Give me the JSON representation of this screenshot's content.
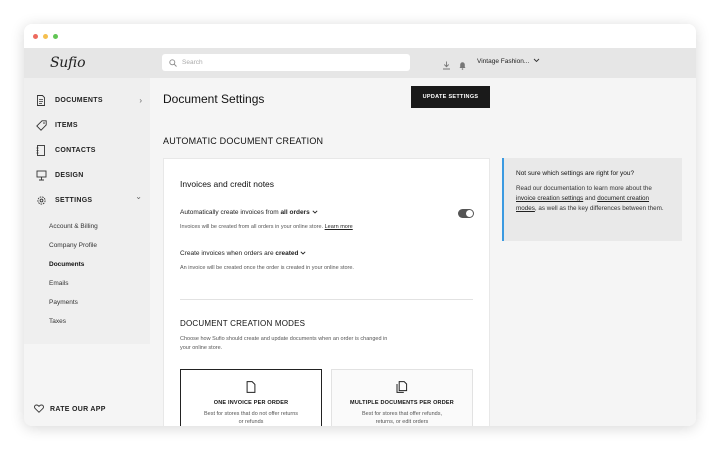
{
  "app": {
    "logo": "Sufio"
  },
  "sidebar": {
    "items": [
      {
        "label": "DOCUMENTS",
        "icon": "document-icon",
        "chevron": "›"
      },
      {
        "label": "ITEMS",
        "icon": "tag-icon"
      },
      {
        "label": "CONTACTS",
        "icon": "address-book-icon"
      },
      {
        "label": "DESIGN",
        "icon": "easel-icon"
      },
      {
        "label": "SETTINGS",
        "icon": "gear-icon",
        "chevron": "⌄"
      }
    ],
    "subitems": [
      "Account & Billing",
      "Company Profile",
      "Documents",
      "Emails",
      "Payments",
      "Taxes"
    ],
    "active_subitem": "Documents",
    "rate": "RATE OUR APP"
  },
  "topbar": {
    "search_placeholder": "Search",
    "store_name": "Vintage Fashion...",
    "icons": [
      "download-icon",
      "bell-icon",
      "chevron-down-icon"
    ]
  },
  "main": {
    "page_title": "Document Settings",
    "update_button": "UPDATE SETTINGS",
    "section_title": "AUTOMATIC DOCUMENT CREATION",
    "card": {
      "title": "Invoices and credit notes",
      "setting1": {
        "label_prefix": "Automatically create invoices from",
        "value": "all orders",
        "desc": "Invoices will be created from all orders in your online store.",
        "link": "Learn more",
        "toggle_on": true
      },
      "setting2": {
        "label_prefix": "Create invoices when orders are",
        "value": "created",
        "desc": "An invoice will be created once the order is created in your online store."
      },
      "modes_title": "DOCUMENT CREATION MODES",
      "modes_desc": "Choose how Sufio should create and update documents when an order is changed in your online store.",
      "modes": [
        {
          "title": "ONE INVOICE PER ORDER",
          "desc": "Best for stores that do not offer returns or refunds",
          "selected": true
        },
        {
          "title": "MULTIPLE DOCUMENTS PER ORDER",
          "desc": "Best for stores that offer refunds, returns, or edit orders",
          "selected": false
        }
      ]
    },
    "help": {
      "title": "Not sure which settings are right for you?",
      "text_1": "Read our documentation to learn more about the",
      "link_1": "invoice creation settings",
      "text_2": "and",
      "link_2": "document creation modes",
      "text_3": ", as well as the key differences between them."
    }
  },
  "colors": {
    "accent": "#3b9ae1",
    "button": "#1a1a1a",
    "sidebar": "#efefef",
    "topbar": "#e6e6e6"
  }
}
